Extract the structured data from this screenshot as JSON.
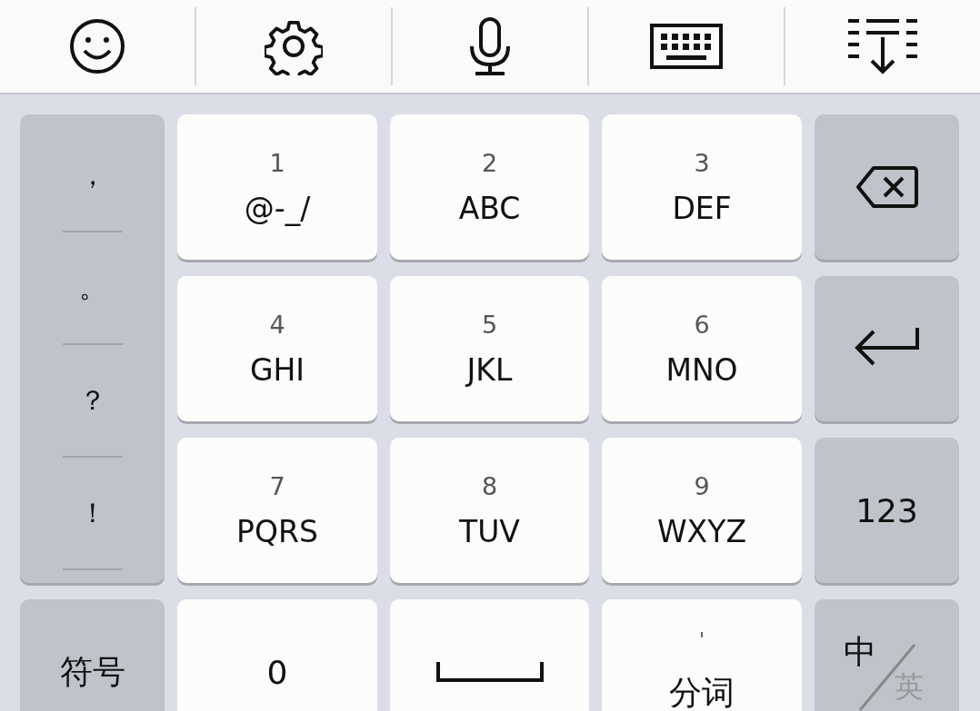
{
  "punctuation": [
    "，",
    "。",
    "？",
    "！"
  ],
  "keys": [
    {
      "digit": "1",
      "letters": "@-_/"
    },
    {
      "digit": "2",
      "letters": "ABC"
    },
    {
      "digit": "3",
      "letters": "DEF"
    },
    {
      "digit": "4",
      "letters": "GHI"
    },
    {
      "digit": "5",
      "letters": "JKL"
    },
    {
      "digit": "6",
      "letters": "MNO"
    },
    {
      "digit": "7",
      "letters": "PQRS"
    },
    {
      "digit": "8",
      "letters": "TUV"
    },
    {
      "digit": "9",
      "letters": "WXYZ"
    }
  ],
  "side_keys": [
    {
      "kind": "backspace"
    },
    {
      "kind": "enter"
    },
    {
      "kind": "text",
      "label": "123"
    }
  ],
  "bottom_row": [
    {
      "kind": "text",
      "label": "符号"
    },
    {
      "kind": "digit",
      "label": "0"
    },
    {
      "kind": "space"
    },
    {
      "kind": "split",
      "hint": "'",
      "label": "分词"
    },
    {
      "kind": "lang",
      "primary": "中",
      "secondary": "英"
    }
  ]
}
